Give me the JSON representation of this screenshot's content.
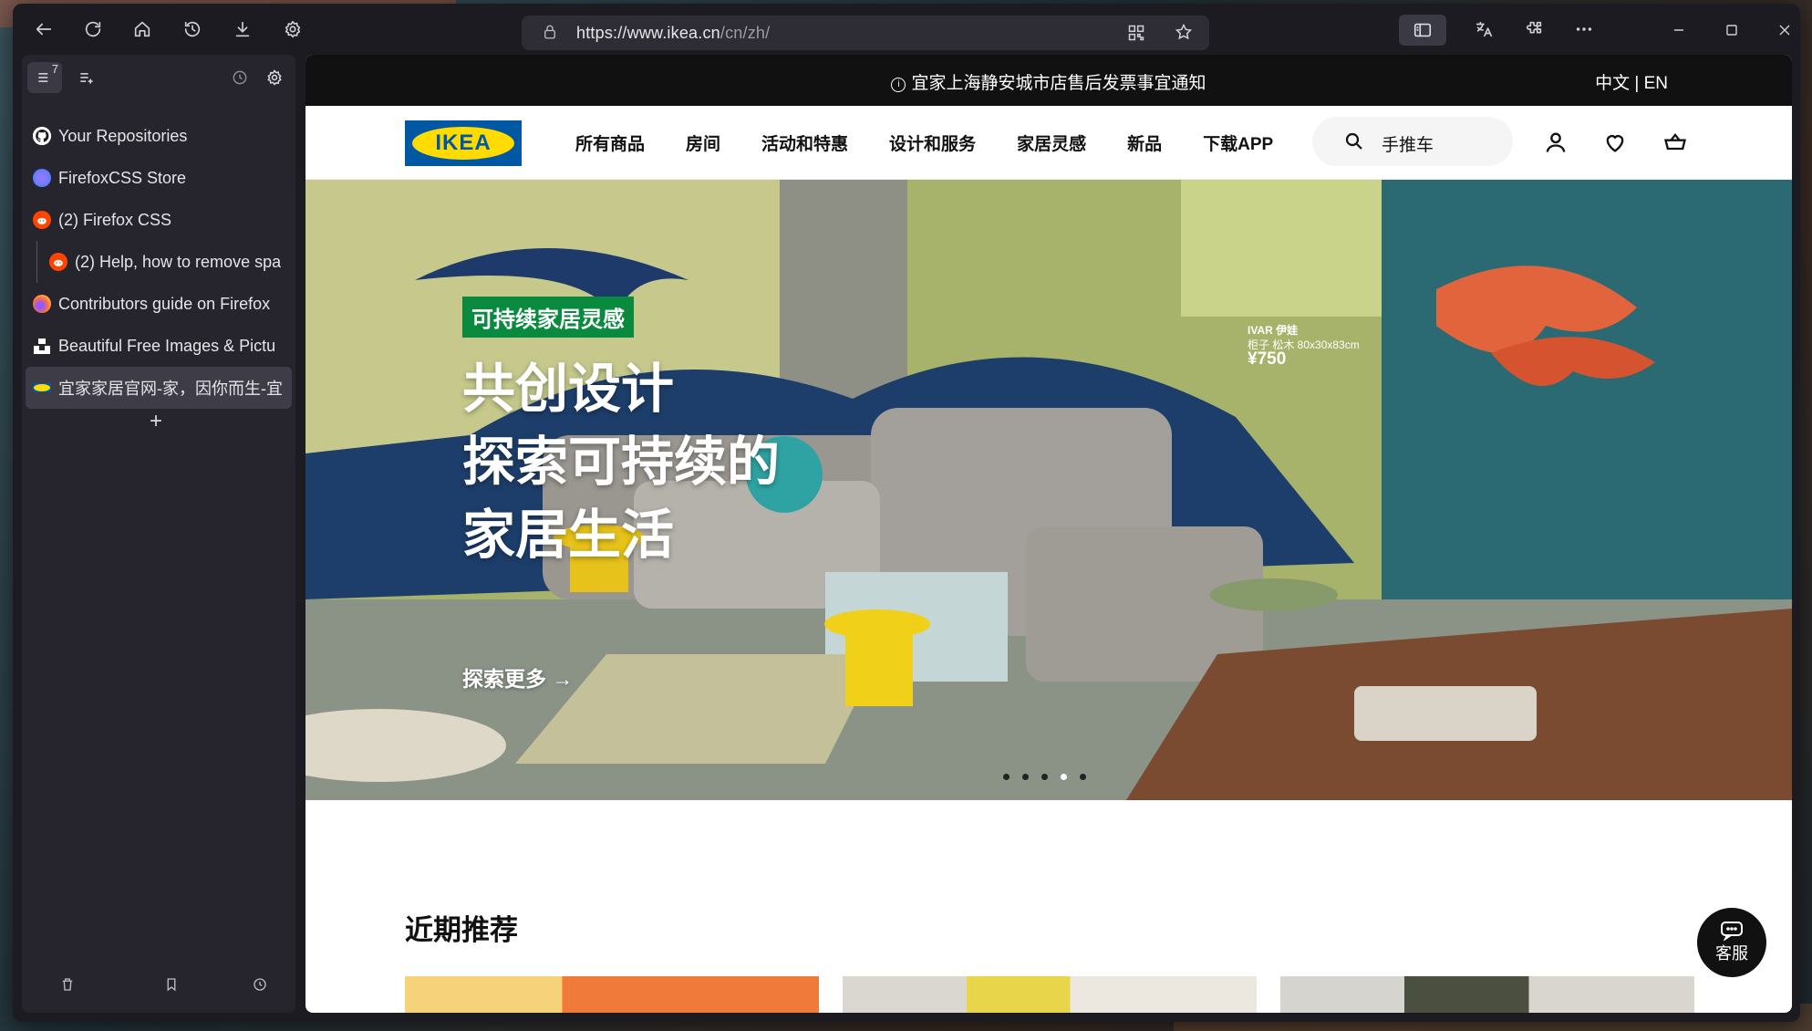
{
  "browser": {
    "url_host": "https://www.ikea.cn",
    "url_path": "/cn/zh/",
    "toolbar_icons": [
      "back-icon",
      "reload-icon",
      "home-icon",
      "history-icon",
      "download-icon",
      "settings-icon"
    ],
    "right_icons": [
      "sidebar-icon",
      "translate-icon",
      "extensions-icon",
      "menu-icon"
    ]
  },
  "sidebar": {
    "tab_count": "7",
    "tabs": [
      {
        "label": "Your Repositories",
        "icon": "github-icon",
        "child": false,
        "active": false
      },
      {
        "label": "FirefoxCSS Store",
        "icon": "firefoxcss-icon",
        "child": false,
        "active": false
      },
      {
        "label": "(2) Firefox CSS",
        "icon": "reddit-icon",
        "child": false,
        "active": false
      },
      {
        "label": "(2) Help, how to remove spa",
        "icon": "reddit-icon",
        "child": true,
        "active": false
      },
      {
        "label": "Contributors guide on Firefox",
        "icon": "firefox-icon",
        "child": false,
        "active": false
      },
      {
        "label": "Beautiful Free Images & Pictu",
        "icon": "unsplash-icon",
        "child": false,
        "active": false
      },
      {
        "label": "宜家家居官网-家，因你而生-宜",
        "icon": "ikea-icon",
        "child": false,
        "active": true
      }
    ],
    "new_tab": "+"
  },
  "page": {
    "notice": "宜家上海静安城市店售后发票事宜通知",
    "lang": "中文 | EN",
    "logo": "IKEA",
    "nav": [
      "所有商品",
      "房间",
      "活动和特惠",
      "设计和服务",
      "家居灵感",
      "新品",
      "下载APP"
    ],
    "search_text": "手推车",
    "hero": {
      "tag": "可持续家居灵感",
      "title_lines": [
        "共创设计",
        "探索可持续的",
        "家居生活"
      ],
      "cta": "探索更多 →",
      "product_name": "IVAR 伊娃",
      "product_desc": "柜子 松木 80x30x83cm",
      "product_price": "¥750",
      "active_slide": 4,
      "slide_count": 5
    },
    "section_title": "近期推荐",
    "chat_label": "客服"
  },
  "colors": {
    "ikea_blue": "#0058a3",
    "ikea_yellow": "#ffdb00",
    "tag_green": "#0a8a3e"
  }
}
